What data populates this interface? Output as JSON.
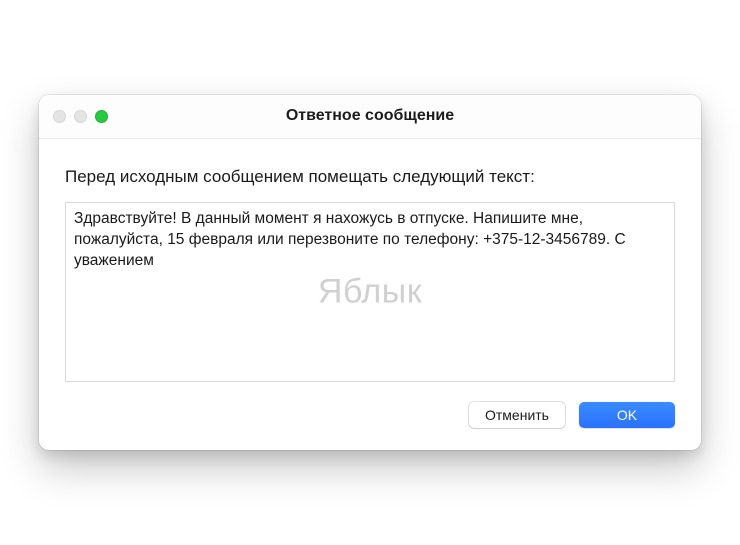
{
  "window": {
    "title": "Ответное сообщение"
  },
  "content": {
    "label": "Перед исходным сообщением помещать следующий текст:",
    "textarea_value": "Здравствуйте! В данный момент я нахожусь в отпуске. Напишите мне, пожалуйста, 15 февраля или перезвоните по телефону: +375-12-3456789. С уважением",
    "watermark": "Яблык"
  },
  "buttons": {
    "cancel": "Отменить",
    "ok": "OK"
  }
}
